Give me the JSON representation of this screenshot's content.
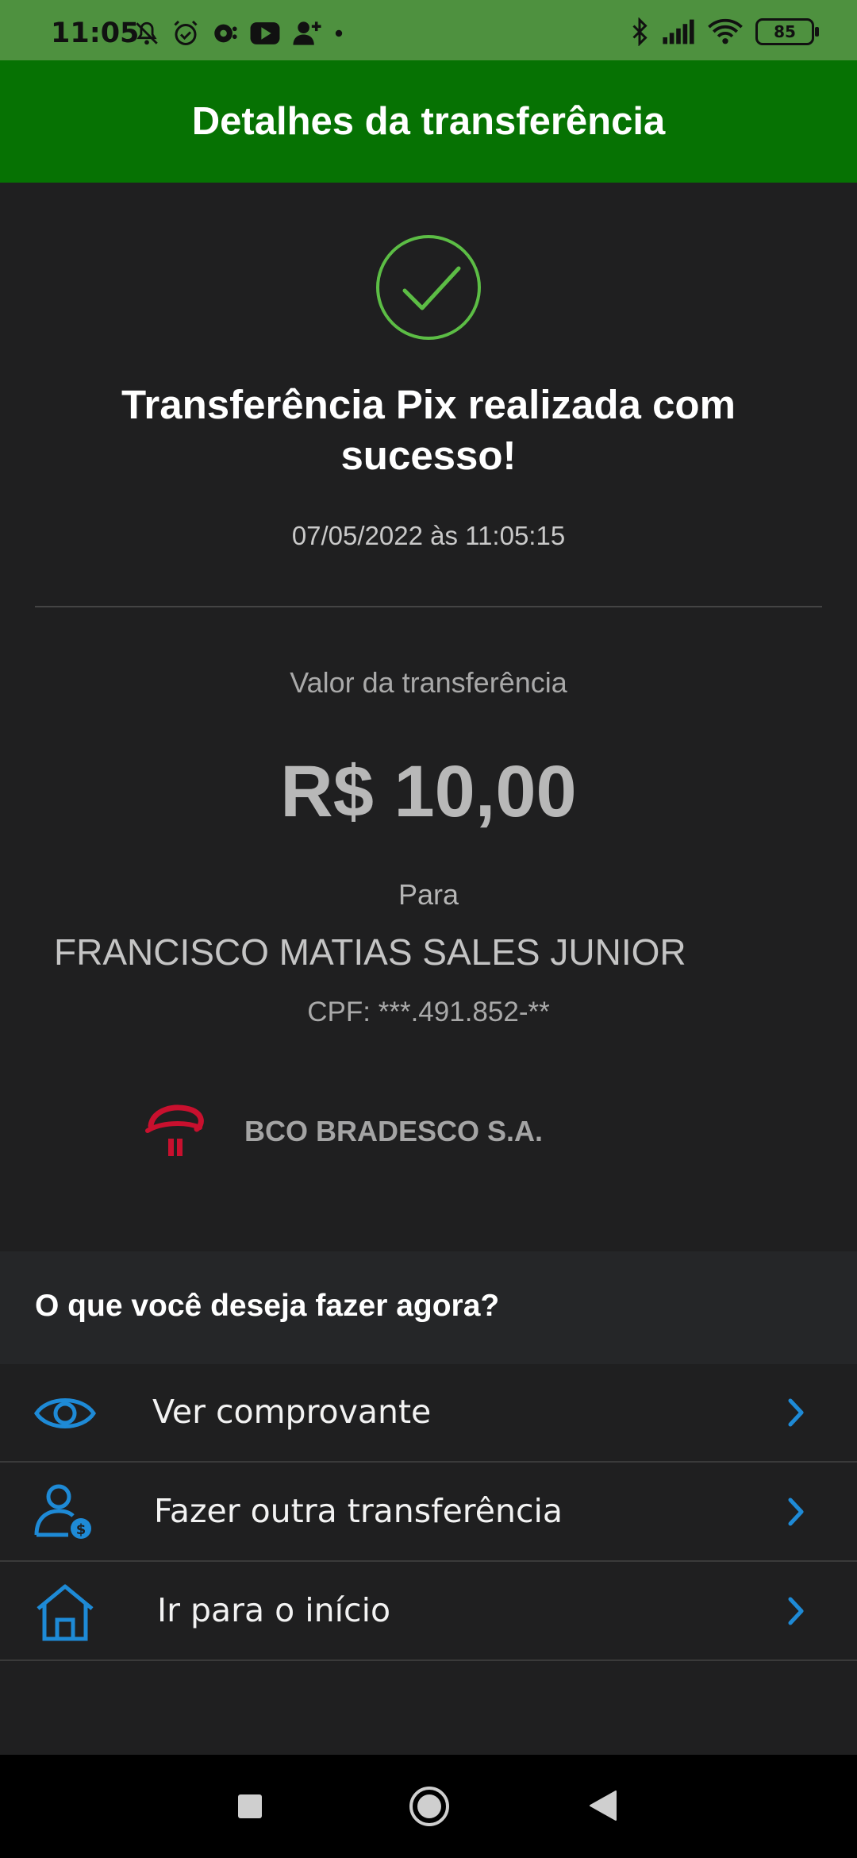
{
  "status_bar": {
    "time": "11:05",
    "battery": "85",
    "icons": [
      "bell-off-icon",
      "alarm-icon",
      "chat-icon",
      "youtube-icon",
      "add-user-icon",
      "dot-icon",
      "bluetooth-icon",
      "signal-icon",
      "wifi-icon"
    ]
  },
  "header": {
    "title": "Detalhes da transferência"
  },
  "result": {
    "headline": "Transferência Pix realizada com sucesso!",
    "datetime": "07/05/2022 às 11:05:15"
  },
  "transfer": {
    "amount_label": "Valor da transferência",
    "amount": "R$ 10,00",
    "to_label": "Para",
    "recipient": "FRANCISCO MATIAS SALES JUNIOR",
    "cpf": "CPF: ***.491.852-**",
    "bank": "BCO BRADESCO S.A."
  },
  "actions": {
    "title": "O que você deseja fazer agora?",
    "items": [
      {
        "label": "Ver comprovante",
        "icon": "eye-icon"
      },
      {
        "label": "Fazer outra transferência",
        "icon": "user-money-icon"
      },
      {
        "label": "Ir para o início",
        "icon": "home-icon"
      }
    ]
  },
  "colors": {
    "status_bar": "#4e913f",
    "app_bar": "#067203",
    "success": "#5cbd45",
    "accent_blue": "#1e8ad6",
    "background": "#1f1f20",
    "bank_red": "#c8102e"
  },
  "nav": {
    "icons": [
      "recents-square-icon",
      "home-circle-icon",
      "back-triangle-icon"
    ]
  }
}
